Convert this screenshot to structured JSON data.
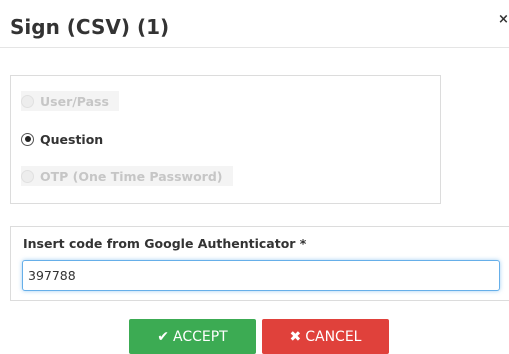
{
  "dialog": {
    "title": "Sign (CSV) (1)",
    "close_symbol": "×"
  },
  "methods": {
    "items": [
      {
        "label": "User/Pass",
        "checked": false,
        "disabled": true
      },
      {
        "label": "Question",
        "checked": true,
        "disabled": false
      },
      {
        "label": "OTP (One Time Password)",
        "checked": false,
        "disabled": true
      }
    ]
  },
  "code": {
    "label": "Insert code from Google Authenticator  *",
    "value": "397788"
  },
  "buttons": {
    "accept_icon": "✔",
    "accept_label": "ACCEPT",
    "cancel_icon": "✖",
    "cancel_label": "CANCEL"
  },
  "colors": {
    "accept": "#3cab53",
    "cancel": "#e0413b",
    "focus_border": "#66afe9"
  }
}
